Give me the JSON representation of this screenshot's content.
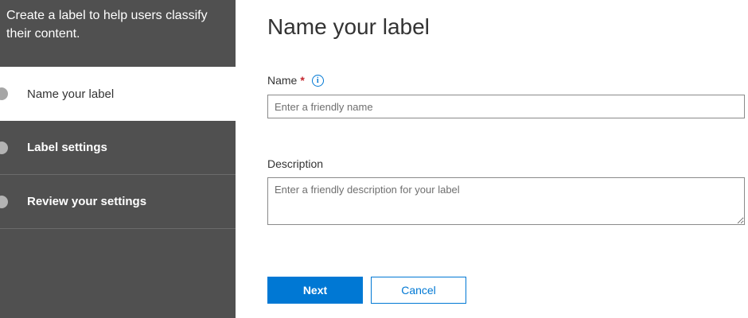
{
  "sidebar": {
    "header": "Create a label to help users classify their content.",
    "steps": [
      {
        "label": "Name your label",
        "state": "active"
      },
      {
        "label": "Label settings",
        "state": "pending"
      },
      {
        "label": "Review your settings",
        "state": "pending"
      }
    ]
  },
  "main": {
    "title": "Name your label",
    "name_field": {
      "label": "Name",
      "required_marker": "*",
      "info_icon": "info-icon",
      "info_glyph": "i",
      "placeholder": "Enter a friendly name",
      "value": ""
    },
    "description_field": {
      "label": "Description",
      "placeholder": "Enter a friendly description for your label",
      "value": ""
    },
    "buttons": {
      "next": "Next",
      "cancel": "Cancel"
    }
  },
  "colors": {
    "sidebar_bg": "#505050",
    "accent": "#0078d4",
    "required": "#c4262e"
  }
}
